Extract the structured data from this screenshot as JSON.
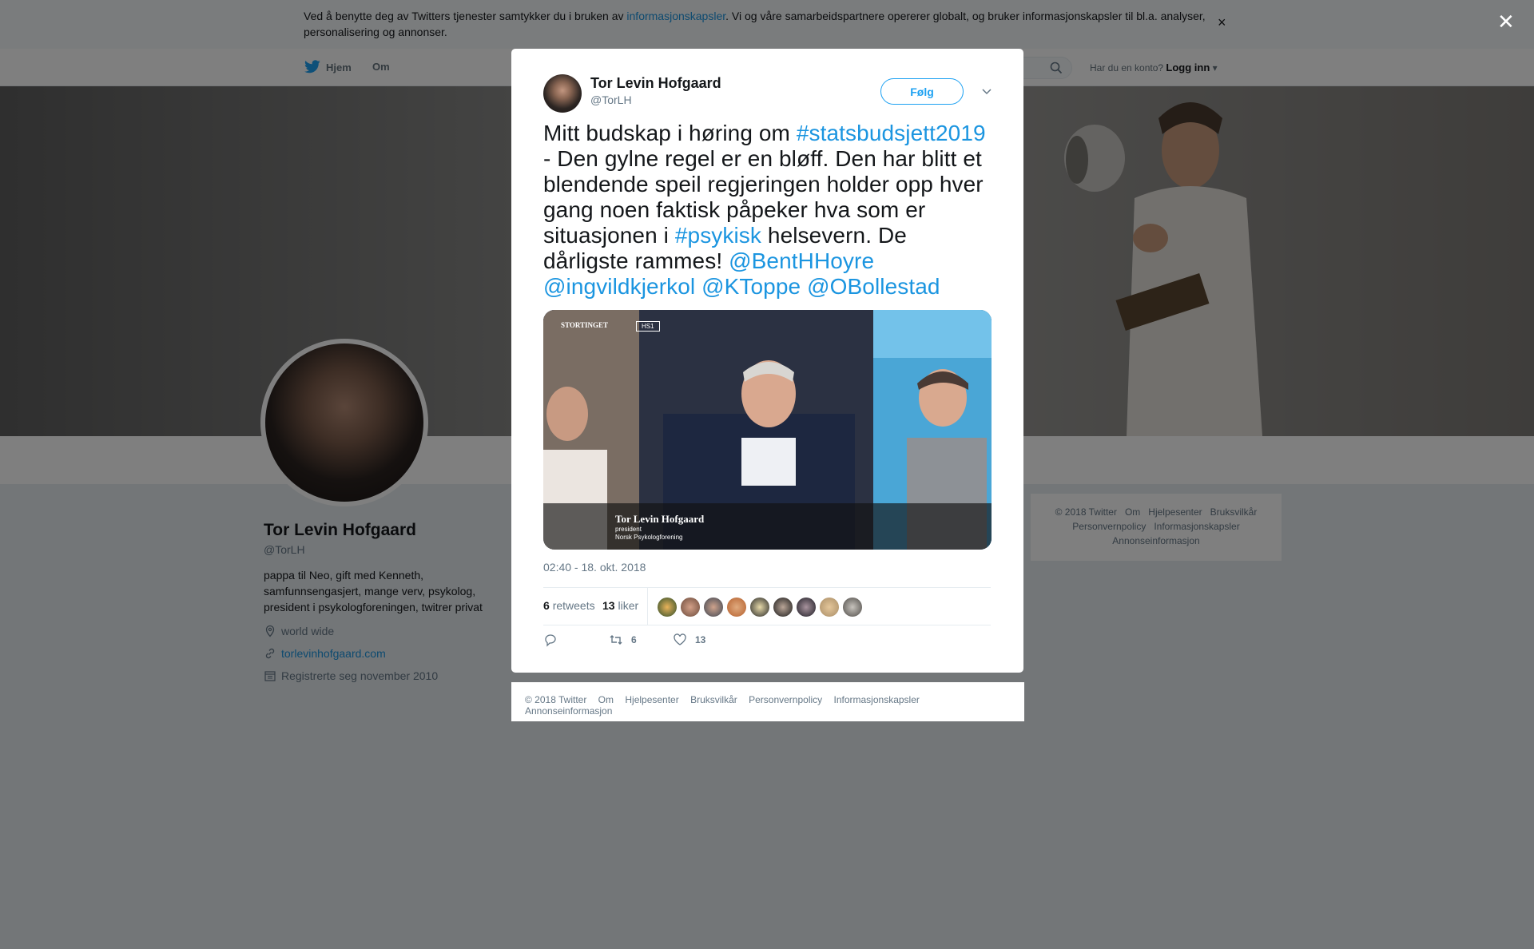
{
  "cookie_bar": {
    "text_before": "Ved å benytte deg av Twitters tjenester samtykker du i bruken av ",
    "link": "informasjonskapsler",
    "text_after": ". Vi og våre samarbeidspartnere opererer globalt, og bruker informasjonskapsler til bl.a. analyser, personalisering og annonser.",
    "close": "×"
  },
  "nav": {
    "home": "Hjem",
    "about": "Om",
    "account_prompt": "Har du en konto?",
    "login": "Logg inn"
  },
  "profile": {
    "name": "Tor Levin Hofgaard",
    "handle": "@TorLH",
    "bio": "pappa til Neo, gift med Kenneth, samfunnsengasjert, mange verv, psykolog, president i psykologforeningen, twitrer privat",
    "location": "world wide",
    "website": "torlevinhofgaard.com",
    "joined": "Registrerte seg november 2010"
  },
  "side_footer": [
    "© 2018 Twitter",
    "Om",
    "Hjelpesenter",
    "Bruksvilkår",
    "Personvernpolicy",
    "Informasjonskapsler",
    "Annonseinformasjon"
  ],
  "overlay_close": "✕",
  "tweet": {
    "author_name": "Tor Levin Hofgaard",
    "author_handle": "@TorLH",
    "follow_label": "Følg",
    "text_1": "Mitt budskap i høring om ",
    "hashtag_1": "#statsbudsjett2019",
    "text_2": " - Den gylne regel er en bløff. Den har blitt et blendende speil regjeringen holder opp hver gang noen faktisk påpeker hva som er situasjonen i ",
    "hashtag_2": "#psykisk",
    "text_3": " helsevern. De dårligste rammes! ",
    "mentions": [
      "@BentHHoyre",
      "@ingvildkjerkol",
      "@KToppe",
      "@OBollestad"
    ],
    "media": {
      "channel": "STORTINGET",
      "badge": "HS1",
      "caption_name": "Tor Levin Hofgaard",
      "caption_role": "president",
      "caption_org": "Norsk Psykologforening"
    },
    "timestamp": "02:40 - 18. okt. 2018",
    "retweets_count": "6",
    "retweets_label": "retweets",
    "likes_count": "13",
    "likes_label": "liker",
    "action_retweet_count": "6",
    "action_like_count": "13"
  },
  "modal_footer": [
    "© 2018 Twitter",
    "Om",
    "Hjelpesenter",
    "Bruksvilkår",
    "Personvernpolicy",
    "Informasjonskapsler",
    "Annonseinformasjon"
  ],
  "colors": {
    "link": "#1b95e0",
    "brand": "#1da1f2",
    "secondary_text": "#657786"
  }
}
